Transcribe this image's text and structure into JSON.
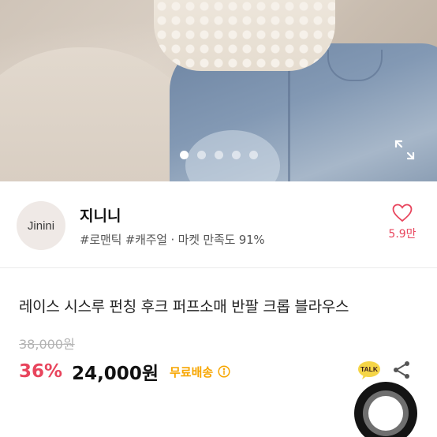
{
  "gallery": {
    "image_count": 5,
    "active_index": 0
  },
  "shop": {
    "avatar_text": "Jinini",
    "name": "지니니",
    "tags": "#로맨틱 #캐주얼 · 마켓 만족도 91%",
    "like_count": "5.9만"
  },
  "product": {
    "title": "레이스 시스루 펀칭 후크 퍼프소매 반팔 크롭 블라우스",
    "original_price": "38,000원",
    "discount": "36%",
    "price": "24,000원",
    "shipping": "무료배송"
  },
  "actions": {
    "talk_label": "TALK"
  },
  "icons": {
    "expand": "expand-icon",
    "heart": "heart-icon",
    "info": "info-icon",
    "talk": "kakao-talk-icon",
    "share": "share-icon"
  },
  "colors": {
    "accent": "#e8455d",
    "shipping": "#f7a600",
    "talk_bubble": "#f5d547"
  }
}
